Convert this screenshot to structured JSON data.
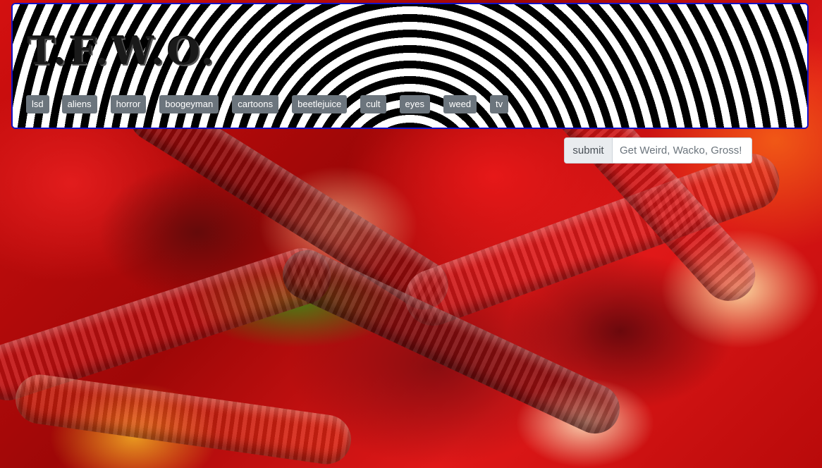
{
  "header": {
    "title": "T.F.W.O.",
    "tags": [
      {
        "label": "lsd"
      },
      {
        "label": "aliens"
      },
      {
        "label": "horror"
      },
      {
        "label": "boogeyman"
      },
      {
        "label": "cartoons"
      },
      {
        "label": "beetlejuice"
      },
      {
        "label": "cult"
      },
      {
        "label": "eyes"
      },
      {
        "label": "weed"
      },
      {
        "label": "tv"
      }
    ]
  },
  "search": {
    "submit_label": "submit",
    "placeholder": "Get Weird, Wacko, Gross!",
    "value": ""
  },
  "colors": {
    "banner_border": "#1010c8",
    "tag_background": "#6c757d",
    "tag_text": "#ffffff",
    "background_theme": "#b30000"
  },
  "background": {
    "icon": "gummy-worms-background-image"
  }
}
